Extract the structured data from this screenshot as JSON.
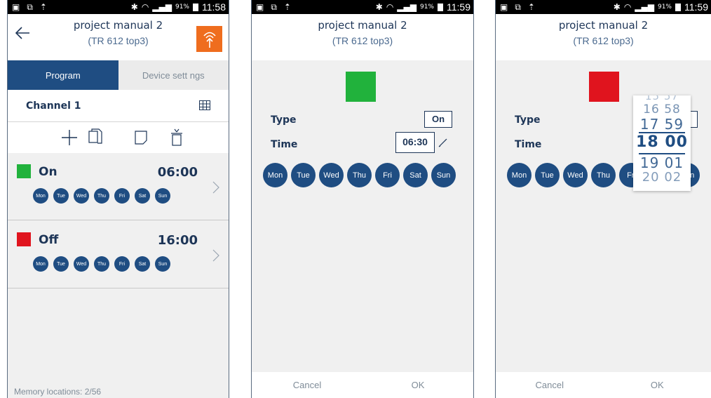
{
  "status": {
    "time1": "11:58",
    "time2": "11:59",
    "time3": "11:59",
    "battery": "91%"
  },
  "header": {
    "title": "project manual 2",
    "subtitle": "(TR 612 top3)"
  },
  "tabs": {
    "program": "Program",
    "device_settings": "Device sett ngs"
  },
  "channel": {
    "label": "Channel 1"
  },
  "entries": [
    {
      "type": "On",
      "time": "06:00",
      "color": "#21b23c",
      "days": [
        "Mon",
        "Tue",
        "Wed",
        "Thu",
        "Fri",
        "Sat",
        "Sun"
      ]
    },
    {
      "type": "Off",
      "time": "16:00",
      "color": "#e0141e",
      "days": [
        "Mon",
        "Tue",
        "Wed",
        "Thu",
        "Fri",
        "Sat",
        "Sun"
      ]
    }
  ],
  "memory": "Memory locations: 2/56",
  "edit": {
    "type_label": "Type",
    "time_label": "Time",
    "type_value": "On",
    "time_value": "06:30",
    "color_on": "#21b23c",
    "color_off": "#e0141e",
    "days": [
      "Mon",
      "Tue",
      "Wed",
      "Thu",
      "Fri",
      "Sat",
      "Sun"
    ]
  },
  "footer": {
    "cancel": "Cancel",
    "ok": "OK"
  },
  "picker": {
    "rows": [
      {
        "h": "16",
        "m": "58"
      },
      {
        "h": "17",
        "m": "59"
      },
      {
        "h": "18",
        "m": "00"
      },
      {
        "h": "19",
        "m": "01"
      },
      {
        "h": "20",
        "m": "02"
      }
    ]
  },
  "colors": {
    "primary": "#1f4d82",
    "accent": "#ef6d1e",
    "text": "#1d3557"
  }
}
